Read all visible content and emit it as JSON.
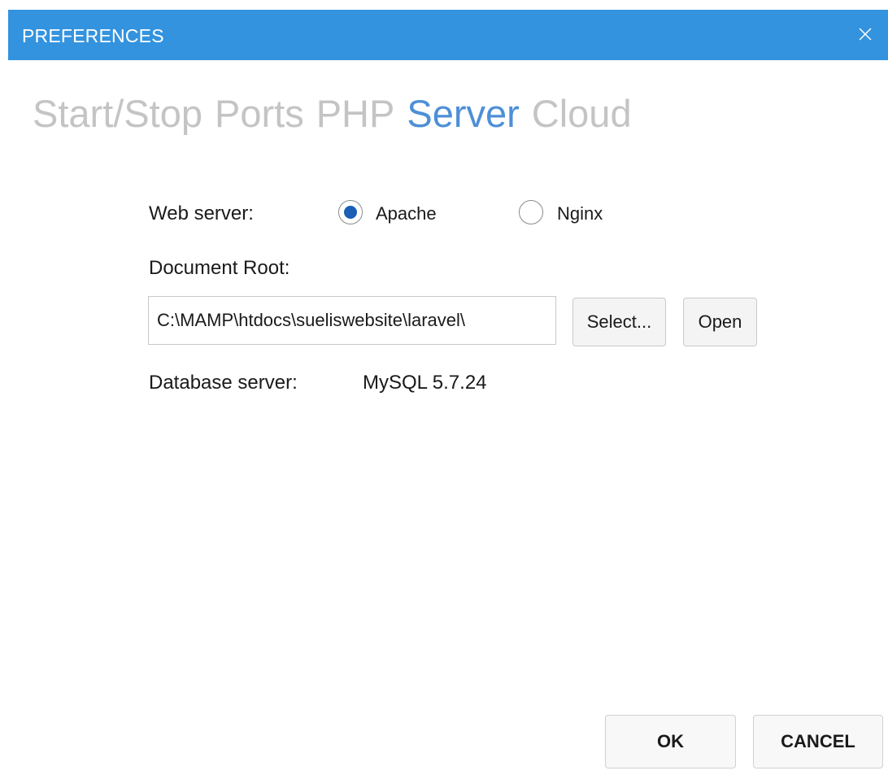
{
  "window": {
    "title": "PREFERENCES",
    "close_icon": "close-icon"
  },
  "tabs": [
    {
      "label": "Start/Stop",
      "active": false
    },
    {
      "label": "Ports",
      "active": false
    },
    {
      "label": "PHP",
      "active": false
    },
    {
      "label": "Server",
      "active": true
    },
    {
      "label": "Cloud",
      "active": false
    }
  ],
  "server": {
    "web_server_label": "Web server:",
    "options": [
      {
        "label": "Apache",
        "selected": true
      },
      {
        "label": "Nginx",
        "selected": false
      }
    ],
    "document_root_label": "Document Root:",
    "document_root_value": "C:\\MAMP\\htdocs\\sueliswebsite\\laravel\\",
    "select_label": "Select...",
    "open_label": "Open",
    "database_label": "Database server:",
    "database_value": "MySQL 5.7.24"
  },
  "footer": {
    "ok_label": "OK",
    "cancel_label": "CANCEL"
  },
  "colors": {
    "titlebar": "#3393df",
    "active_tab": "#4e8fd6",
    "inactive_tab": "#c4c4c4",
    "radio_selected": "#1a5fb4"
  }
}
